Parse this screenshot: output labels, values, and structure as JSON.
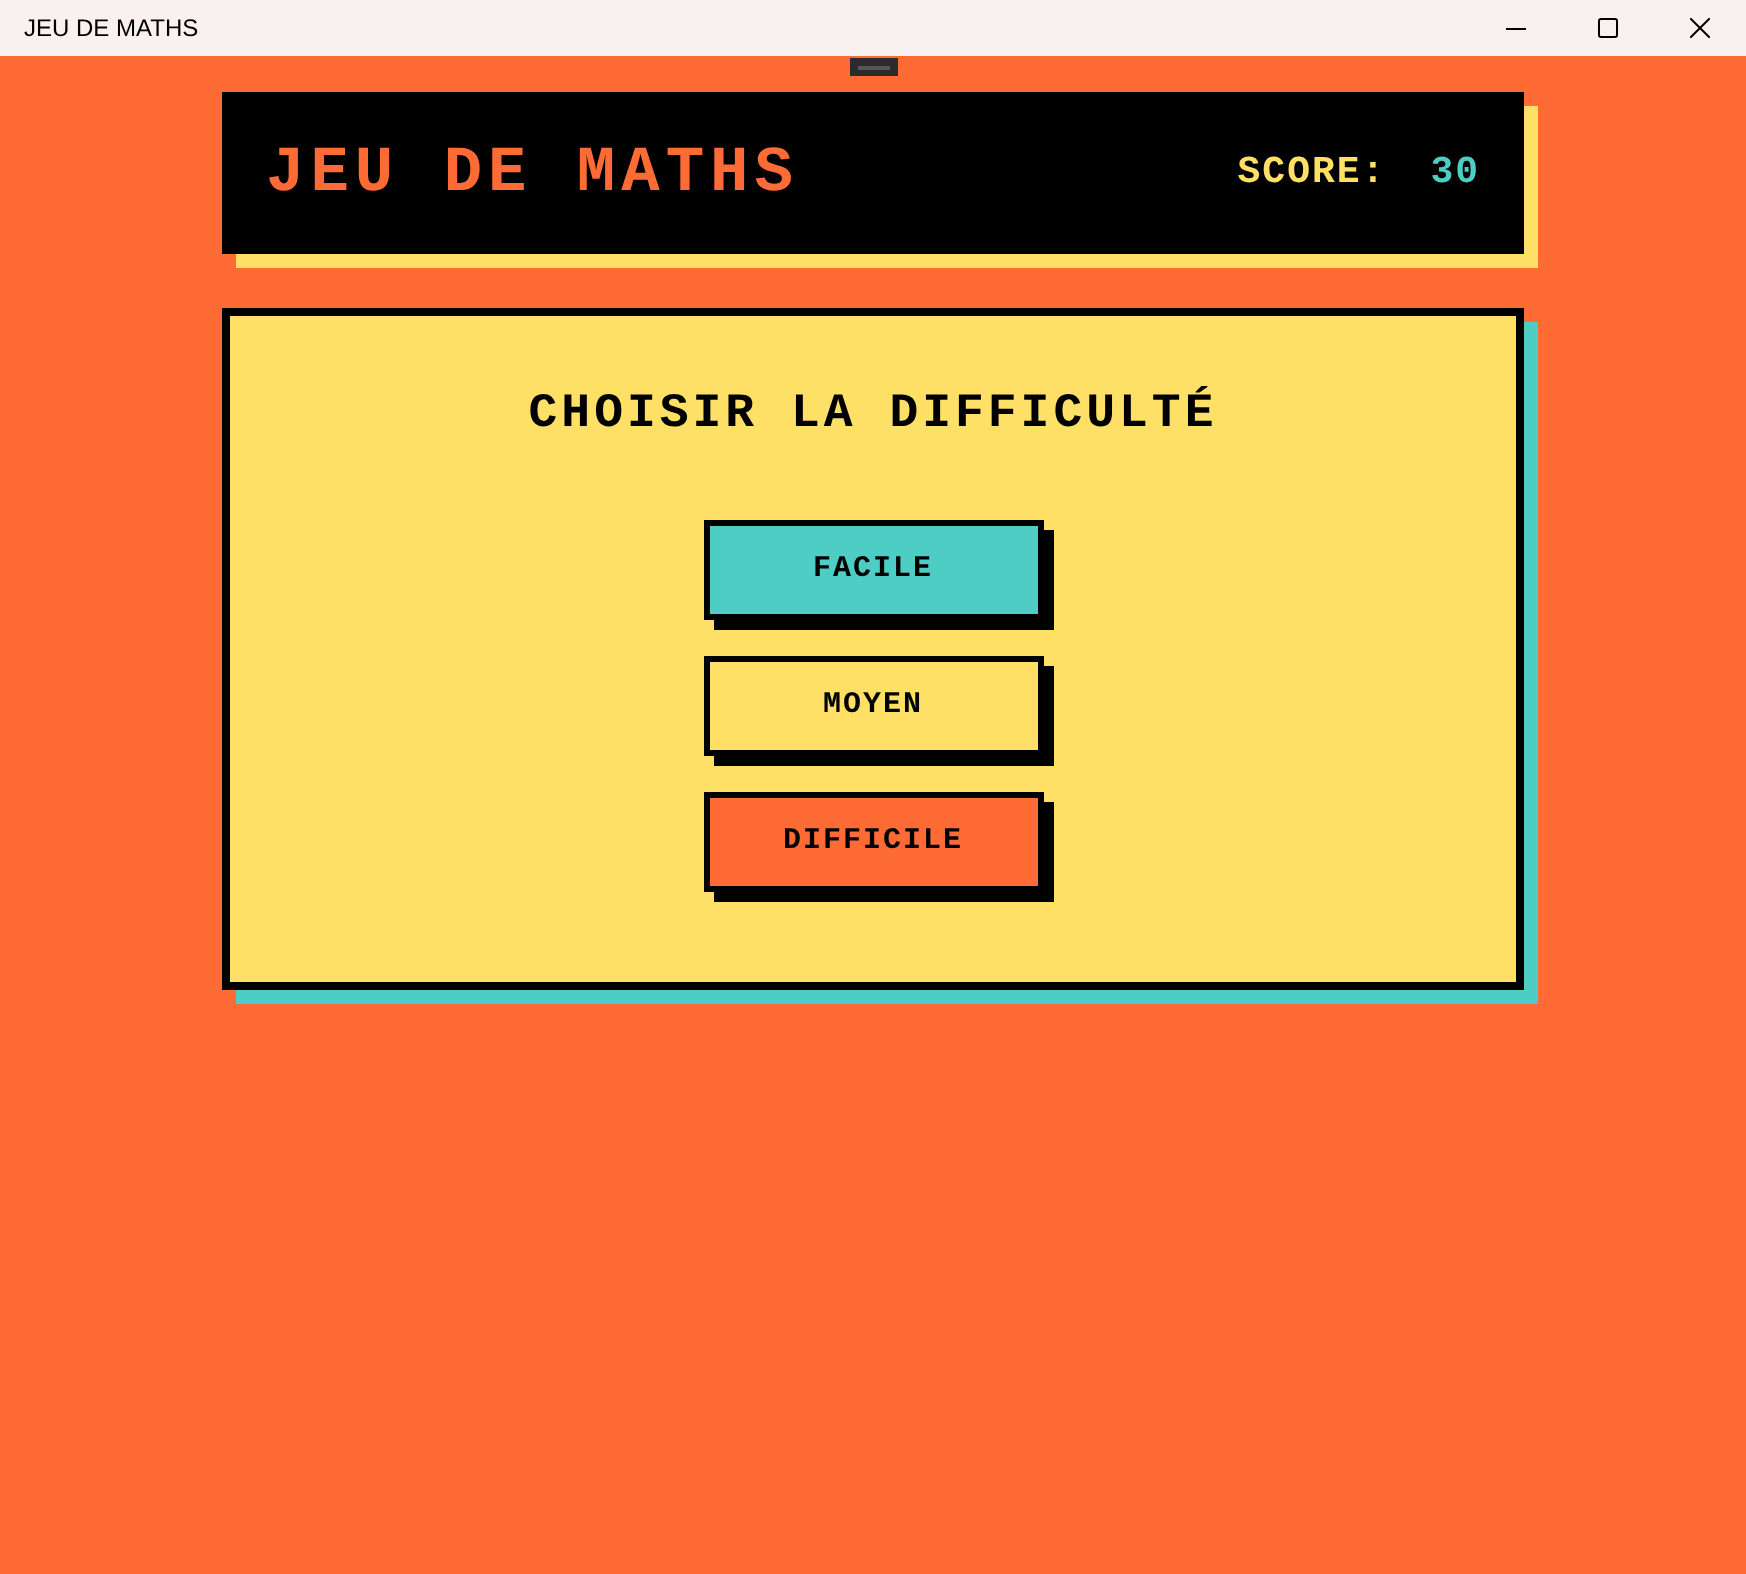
{
  "window": {
    "title": "JEU DE MATHS"
  },
  "header": {
    "title": "JEU DE MATHS",
    "score_label": "SCORE:",
    "score_value": "30"
  },
  "panel": {
    "heading": "CHOISIR LA DIFFICULTÉ",
    "options": [
      {
        "label": "FACILE",
        "color": "#4ecdc4"
      },
      {
        "label": "MOYEN",
        "color": "#ffe066"
      },
      {
        "label": "DIFFICILE",
        "color": "#ff6b35"
      }
    ]
  }
}
